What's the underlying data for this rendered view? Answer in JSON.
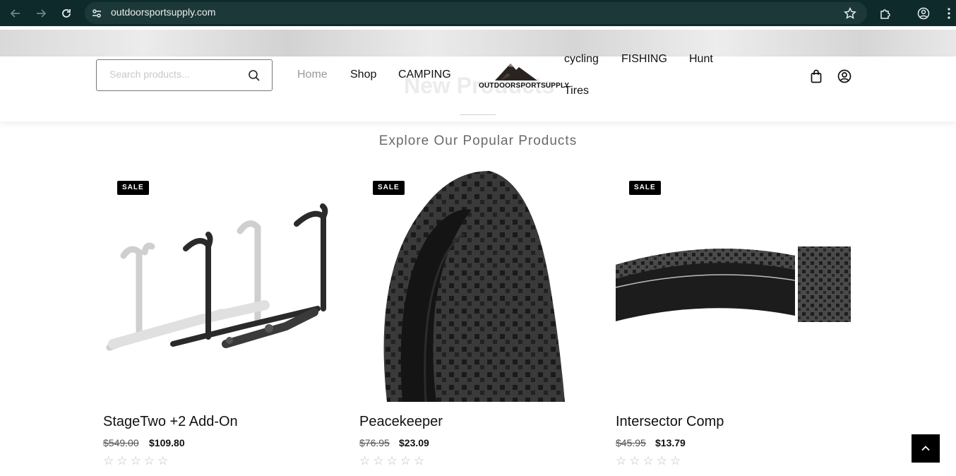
{
  "browser": {
    "url": "outdoorsportsupply.com",
    "icons": [
      "back-arrow-icon",
      "forward-arrow-icon",
      "reload-icon",
      "site-info-icon",
      "bookmark-star-icon",
      "extensions-icon",
      "profile-icon",
      "menu-kebab-icon"
    ]
  },
  "header": {
    "search": {
      "placeholder": "Search products..."
    },
    "nav": {
      "home": "Home",
      "shop": "Shop",
      "camping": "CAMPING",
      "cycling": "cycling",
      "fishing": "FISHING",
      "hunt": "Hunt",
      "tires": "Tires"
    },
    "logo_text": "OUTDOORSPORTSUPPLY",
    "background_heading": "New Products"
  },
  "section": {
    "title": "Explore Our Popular Products"
  },
  "products": [
    {
      "badge": "SALE",
      "name": "StageTwo +2 Add-On",
      "old_price": "$549.00",
      "price": "$109.80",
      "rating": 0
    },
    {
      "badge": "SALE",
      "name": "Peacekeeper",
      "old_price": "$76.95",
      "price": "$23.09",
      "rating": 0
    },
    {
      "badge": "SALE",
      "name": "Intersector Comp",
      "old_price": "$45.95",
      "price": "$13.79",
      "rating": 0
    }
  ],
  "stars": [
    "☆",
    "☆",
    "☆",
    "☆",
    "☆"
  ],
  "colors": {
    "chrome": "#0f2a2a",
    "accent": "#000000",
    "nav_muted": "#9a9a9a"
  }
}
